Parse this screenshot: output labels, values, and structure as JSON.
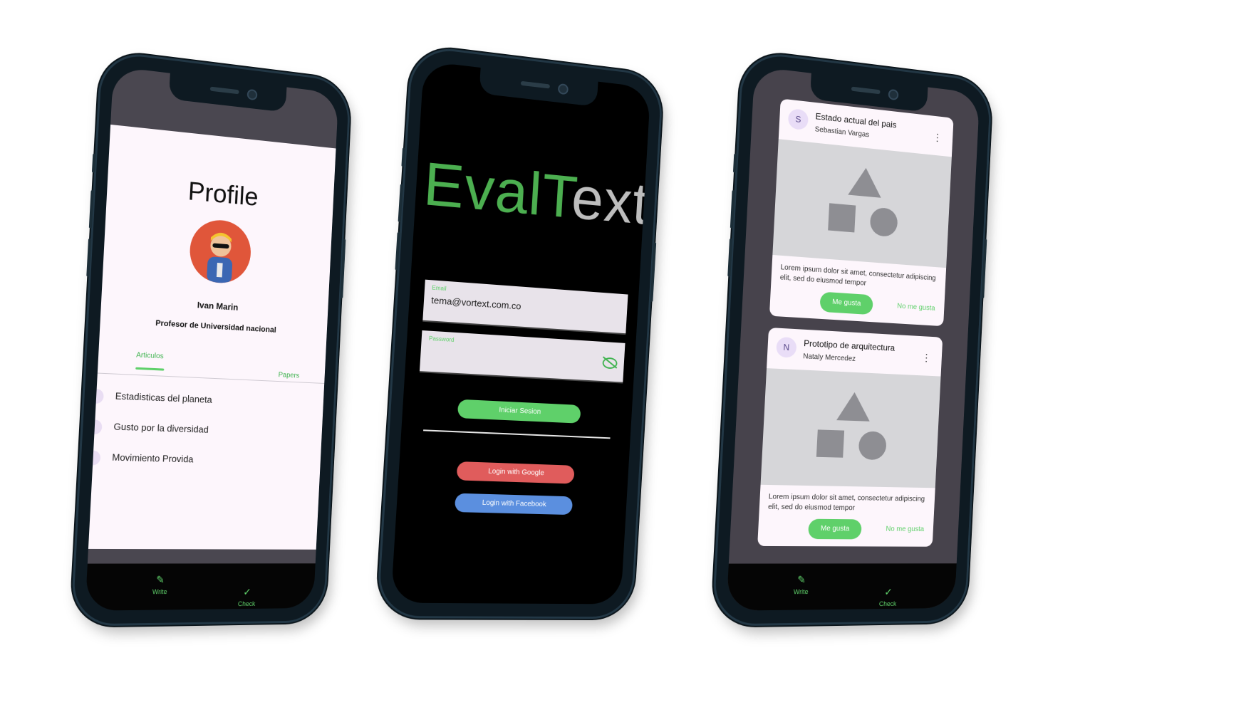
{
  "profile_screen": {
    "title": "Profile",
    "user_name": "Ivan Marin",
    "role": "Profesor de  Universidad nacional",
    "tabs": [
      {
        "label": "Articulos"
      },
      {
        "label": "Papers"
      }
    ],
    "articles": [
      {
        "title": "Estadisticas del planeta"
      },
      {
        "title": "Gusto por la diversidad"
      },
      {
        "title": "Movimiento Provida"
      }
    ],
    "bottom_nav": [
      {
        "label": "Write",
        "icon": "pencil-icon"
      },
      {
        "label": "Check",
        "icon": "check-icon"
      }
    ]
  },
  "login_screen": {
    "brand_part1": "EvalT",
    "brand_part2": "ext",
    "email": {
      "label": "Email",
      "value": "tema@vortext.com.co"
    },
    "password": {
      "label": "Password",
      "value": ""
    },
    "login_button": "Iniciar Sesion",
    "google_button": "Login with Google",
    "facebook_button": "Login with Facebook",
    "colors": {
      "brand_green": "#4caf50",
      "google": "#e05c5c",
      "facebook": "#5b8fdf",
      "primary": "#5fd06a"
    }
  },
  "feed_screen": {
    "cards": [
      {
        "avatar_letter": "S",
        "title": "Estado actual del pais",
        "author": "Sebastian Vargas",
        "body": "Lorem ipsum dolor sit amet, consectetur adipiscing elit, sed do eiusmod tempor",
        "like_label": "Me gusta",
        "dislike_label": "No me gusta"
      },
      {
        "avatar_letter": "N",
        "title": "Prototipo de arquitectura",
        "author": "Nataly Mercedez",
        "body": "Lorem ipsum dolor sit amet, consectetur adipiscing elit, sed do eiusmod tempor",
        "like_label": "Me gusta",
        "dislike_label": "No me gusta"
      }
    ],
    "bottom_nav": [
      {
        "label": "Write",
        "icon": "pencil-icon"
      },
      {
        "label": "Check",
        "icon": "check-icon"
      }
    ]
  }
}
